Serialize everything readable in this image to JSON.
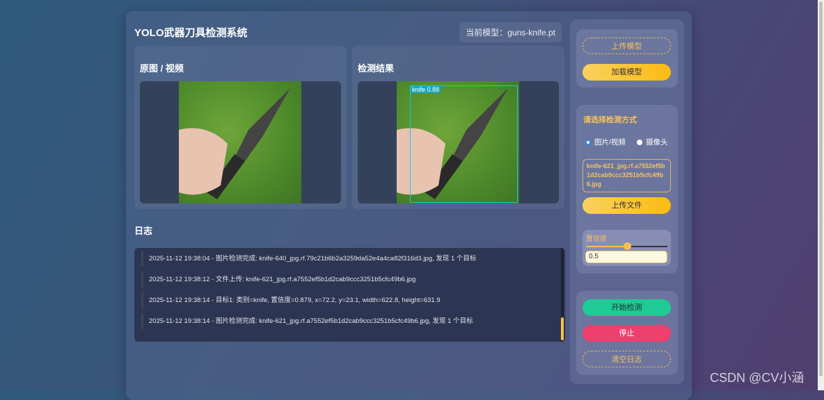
{
  "header": {
    "title": "YOLO武器刀具检测系统",
    "current_model": "当前模型：guns-knife.pt"
  },
  "panels": {
    "original_title": "原图 / 视频",
    "result_title": "检测结果",
    "detection_label": "knife 0.88"
  },
  "log": {
    "title": "日志",
    "entries": [
      "2025-11-12 19:38:04 - 图片检测完成: knife-640_jpg.rf.79c21b6b2a3259da52e4a4ca82f316d3.jpg, 发现 1 个目标",
      "2025-11-12 19:38:12 - 文件上传: knife-621_jpg.rf.a7552ef5b1d2cab9ccc3251b5cfc49b6.jpg",
      "2025-11-12 19:38:14 - 目标1: 类别=knife, 置信度=0.879, x=72.2, y=23.1, width=622.8, height=631.9",
      "2025-11-12 19:38:14 - 图片检测完成: knife-621_jpg.rf.a7552ef5b1d2cab9ccc3251b5cfc49b6.jpg, 发现 1 个目标"
    ]
  },
  "sidebar": {
    "upload_model": "上传模型",
    "load_model": "加载模型",
    "mode_title": "请选择检测方式",
    "mode_image": "图片/视频",
    "mode_camera": "摄像头",
    "file_name": "knife-621_jpg.rf.a7552ef5b1d2cab9ccc3251b5cfc49b6.jpg",
    "upload_file": "上传文件",
    "confidence_label": "置信度",
    "confidence_value": "0.5",
    "confidence": 0.5,
    "start": "开始检测",
    "stop": "停止",
    "clear_log": "清空日志"
  },
  "watermark": "CSDN @CV小涵"
}
